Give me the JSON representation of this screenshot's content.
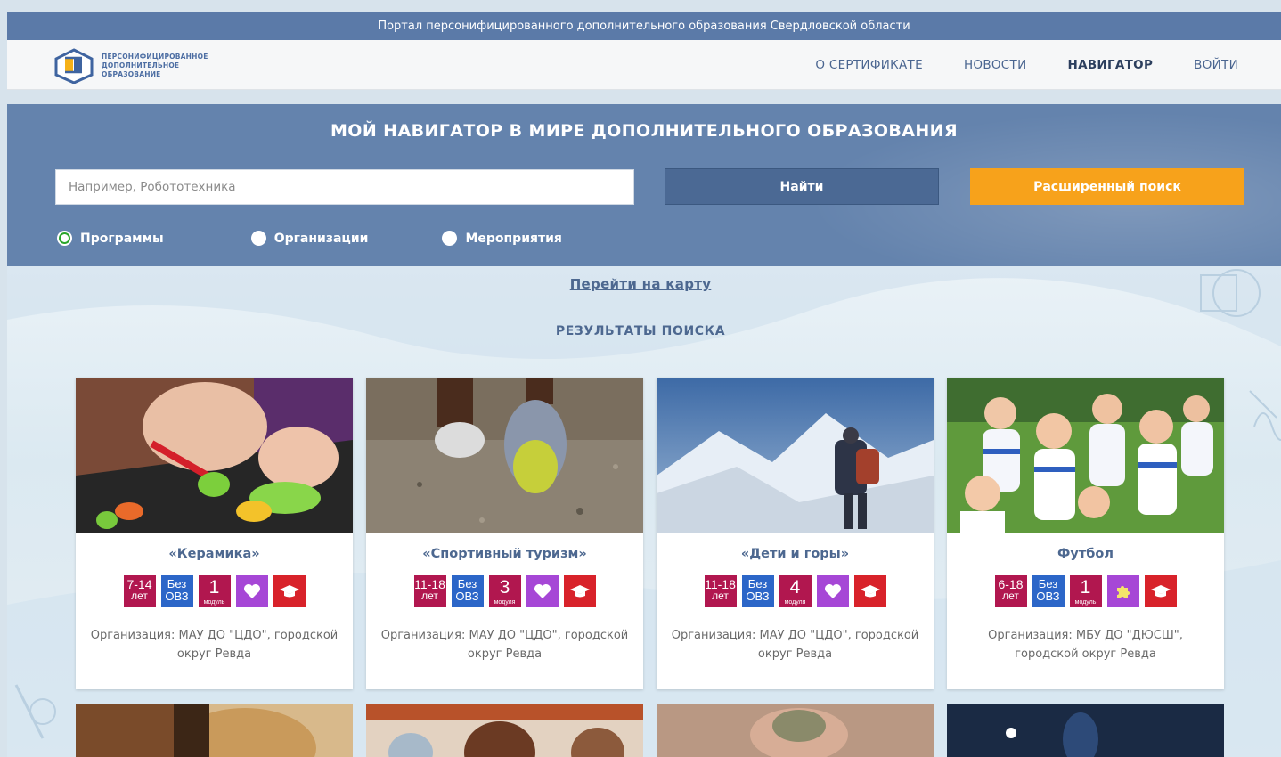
{
  "top_banner": "Портал персонифицированного дополнительного образования Свердловской области",
  "logo": {
    "text": "ПЕРСОНИФИЦИРОВАННОЕ ДОПОЛНИТЕЛЬНОЕ ОБРАЗОВАНИЕ"
  },
  "nav": {
    "items": [
      {
        "label": "О СЕРТИФИКАТЕ"
      },
      {
        "label": "НОВОСТИ"
      },
      {
        "label": "НАВИГАТОР"
      },
      {
        "label": "ВОЙТИ"
      }
    ],
    "active": "НАВИГАТОР"
  },
  "search": {
    "title": "МОЙ НАВИГАТОР В МИРЕ ДОПОЛНИТЕЛЬНОГО ОБРАЗОВАНИЯ",
    "placeholder": "Например, Робототехника",
    "value": "",
    "find_label": "Найти",
    "advanced_label": "Расширенный поиск",
    "options": [
      {
        "label": "Программы",
        "selected": true
      },
      {
        "label": "Организации",
        "selected": false
      },
      {
        "label": "Мероприятия",
        "selected": false
      }
    ]
  },
  "map_link": "Перейти на карту",
  "results_title": "РЕЗУЛЬТАТЫ ПОИСКА",
  "colors": {
    "banner": "#5b7aa8",
    "panel": "#6483ad",
    "find_button": "#4b6994",
    "advanced_button": "#f7a21b",
    "age_badge": "#b1174f",
    "ovz_badge": "#2c66c8",
    "heart_badge": "#a647d6",
    "cap_badge": "#d8222a",
    "link": "#4d6890"
  },
  "cards": [
    {
      "title": "«Керамика»",
      "age": "7-14",
      "age_unit": "лет",
      "ovz_line1": "Без",
      "ovz_line2": "ОВЗ",
      "modules": "1",
      "modules_unit": "модуль",
      "icon4": "heart-icon",
      "org": "Организация: МАУ ДО \"ЦДО\", городской округ Ревда",
      "image": "child modeling clay"
    },
    {
      "title": "«Спортивный туризм»",
      "age": "11-18",
      "age_unit": "лет",
      "ovz_line1": "Без",
      "ovz_line2": "ОВЗ",
      "modules": "3",
      "modules_unit": "модуля",
      "icon4": "heart-icon",
      "org": "Организация: МАУ ДО \"ЦДО\", городской округ Ревда",
      "image": "running shoes on trail"
    },
    {
      "title": "«Дети и горы»",
      "age": "11-18",
      "age_unit": "лет",
      "ovz_line1": "Без",
      "ovz_line2": "ОВЗ",
      "modules": "4",
      "modules_unit": "модуля",
      "icon4": "heart-icon",
      "org": "Организация: МАУ ДО \"ЦДО\", городской округ Ревда",
      "image": "hiker on snowy mountain"
    },
    {
      "title": "Футбол",
      "age": "6-18",
      "age_unit": "лет",
      "ovz_line1": "Без",
      "ovz_line2": "ОВЗ",
      "modules": "1",
      "modules_unit": "модуль",
      "icon4": "puzzle-icon",
      "org": "Организация: МБУ ДО \"ДЮСШ\", городской округ Ревда",
      "image": "football team kids"
    }
  ]
}
